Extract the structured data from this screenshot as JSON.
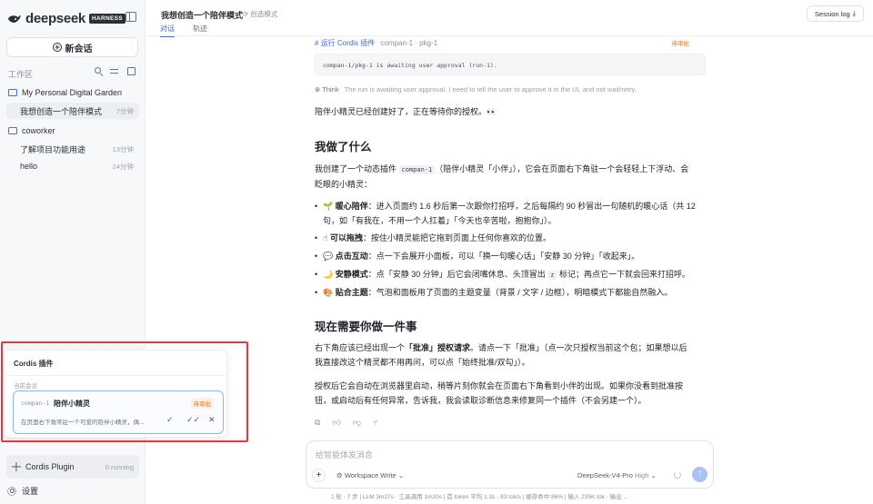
{
  "brand": {
    "name": "deepseek",
    "badge": "HARNESS"
  },
  "sidebar": {
    "new_chat": "新会话",
    "workspace_label": "工作区",
    "folders": [
      {
        "name": "My Personal Digital Garden",
        "sessions": [
          {
            "title": "我想创造一个陪伴模式",
            "time": "7分钟",
            "active": true
          }
        ]
      },
      {
        "name": "coworker",
        "sessions": [
          {
            "title": "了解项目功能用途",
            "time": "13分钟"
          },
          {
            "title": "hello",
            "time": "24分钟"
          }
        ]
      }
    ],
    "cordis_plugin": {
      "label": "Cordis Plugin",
      "status": "0 running"
    },
    "settings": "设置"
  },
  "popup": {
    "title": "Cordis 插件",
    "subtitle": "当前会话",
    "plugin_id": "compan-1",
    "plugin_name": "陪伴小精灵",
    "badge": "待审批",
    "description": "在页面右下角常驻一个可爱的陪伴小精灵，偶..."
  },
  "header": {
    "title": "我想创造一个陪伴模式",
    "mode": "创造模式",
    "tabs": [
      "对话",
      "轨迹"
    ],
    "session_log": "Session log"
  },
  "content": {
    "tool_name": "运行 Cordis 插件",
    "tool_sub": "compan-1 · pkg-1",
    "tool_badge": "待审批",
    "code": "compan-1/pkg-1 is awaiting user approval (run-1).",
    "think_label": "Think",
    "think_text": "The run is awaiting user approval. I need to tell the user to approve it in the UI, and not wait/retry.",
    "intro": "陪伴小精灵已经创建好了，正在等待你的授权。👀",
    "h_done": "我做了什么",
    "done_p1": "我创建了一个动态插件",
    "done_code": "compan-1",
    "done_p2": "（陪伴小精灵「小伴」），它会在页面右下角驻一个会轻轻上下浮动、会",
    "done_p3": "眨眼的小精灵：",
    "bullets": [
      {
        "emoji": "🌱",
        "title": "暖心陪伴",
        "text": "：进入页面约 1.6 秒后第一次跟你打招呼，之后每隔约 90 秒冒出一句随机的暖心话（共 12",
        "text2": "句，如「有我在，不用一个人扛着」「今天也辛苦啦，抱抱你」）。"
      },
      {
        "emoji": "☝",
        "title": "可以拖拽",
        "text": "：按住小精灵能把它拖到页面上任何你喜欢的位置。"
      },
      {
        "emoji": "💬",
        "title": "点击互动",
        "text": "：点一下会展开小面板，可以「换一句暖心话」「安静 30 分钟」「收起来」。"
      },
      {
        "emoji": "🌙",
        "title": "安静模式",
        "text": "：点「安静 30 分钟」后它会闭嘴休息、头顶冒出",
        "code": "z",
        "text_after": "标记；再点它一下就会回来打招呼。"
      },
      {
        "emoji": "🎨",
        "title": "贴合主题",
        "text": "：气泡和面板用了页面的主题变量（背景 / 文字 / 边框），明暗模式下都能自然融入。"
      }
    ],
    "h_now": "现在需要你做一件事",
    "now_p1a": "右下角应该已经出现一个",
    "now_p1b": "「批准」授权请求",
    "now_p1c": "。请点一下「批准」（点一次只授权当前这个包；如果想以后",
    "now_p1d": "我直接改这个精灵都不用再问，可以点「始终批准/双勾」）。",
    "now_p2a": "授权后它会自动在浏览器里启动，稍等片刻你就会在页面右下角看到小伴的出现。如果你没看到批准按",
    "now_p2b": "钮，或启动后有任何异常，告诉我，我会读取诊断信息来修复同一个插件（不会另建一个）。"
  },
  "composer": {
    "placeholder": "给智能体发消息",
    "workspace_mode": "Workspace Write",
    "model": "DeepSeek-V4-Pro",
    "effort": "High"
  },
  "statusbar": "1 轮 · 7 步    |    LLM 3m27s · 工具调用 1m20s    |    首 token 平均 1.3s · 83 tok/s    |    缓存命中 86%    |    输入 235K tok · 输出 ...",
  "colors": {
    "accent": "#3c6ae0",
    "warning": "#d97a2b",
    "highlight_outline": "#e0393e"
  }
}
